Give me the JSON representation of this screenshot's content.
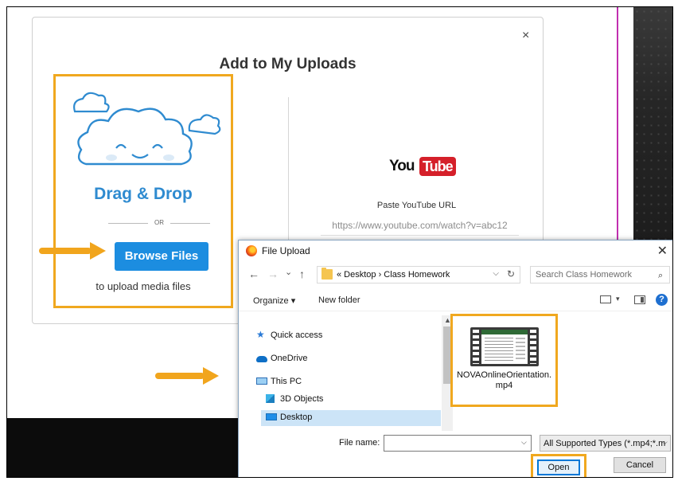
{
  "upload_modal": {
    "title": "Add to My Uploads",
    "close_glyph": "×",
    "drag_drop": {
      "heading": "Drag & Drop",
      "or_text": "OR",
      "browse_label": "Browse Files",
      "note": "to upload media files",
      "icon": "cloud-icon"
    },
    "youtube": {
      "logo_you": "You",
      "logo_tube": "Tube",
      "label": "Paste YouTube URL",
      "placeholder": "https://www.youtube.com/watch?v=abc12"
    }
  },
  "file_dialog": {
    "title": "File Upload",
    "close_glyph": "✕",
    "nav": {
      "back": "←",
      "forward": "→",
      "recent": "⌄",
      "up": "↑"
    },
    "address": "«  Desktop  ›  Class Homework",
    "address_dropdown": "⌵",
    "refresh": "↻",
    "search_placeholder": "Search Class Homework",
    "search_glyph": "⌕",
    "toolbar": {
      "organize": "Organize ▾",
      "new_folder": "New folder",
      "help": "?",
      "view_caret": "▾"
    },
    "nav_items": [
      {
        "label": "Quick access",
        "icon": "star-icon"
      },
      {
        "label": "OneDrive",
        "icon": "onedrive-icon"
      },
      {
        "label": "This PC",
        "icon": "computer-icon"
      },
      {
        "label": "3D Objects",
        "icon": "3d-objects-icon"
      },
      {
        "label": "Desktop",
        "icon": "desktop-icon"
      }
    ],
    "file": {
      "name": "NOVAOnlineOrientation.mp4"
    },
    "file_name_label": "File name:",
    "file_name_value": "",
    "file_name_caret": "⌵",
    "file_type": "All Supported Types (*.mp4;*.m",
    "file_type_caret": "⌵",
    "open_label": "Open",
    "cancel_label": "Cancel"
  },
  "colors": {
    "highlight": "#f0a81f",
    "brand_blue": "#2f8bd0",
    "button_blue": "#1c8de0",
    "youtube_red": "#d5202a"
  }
}
